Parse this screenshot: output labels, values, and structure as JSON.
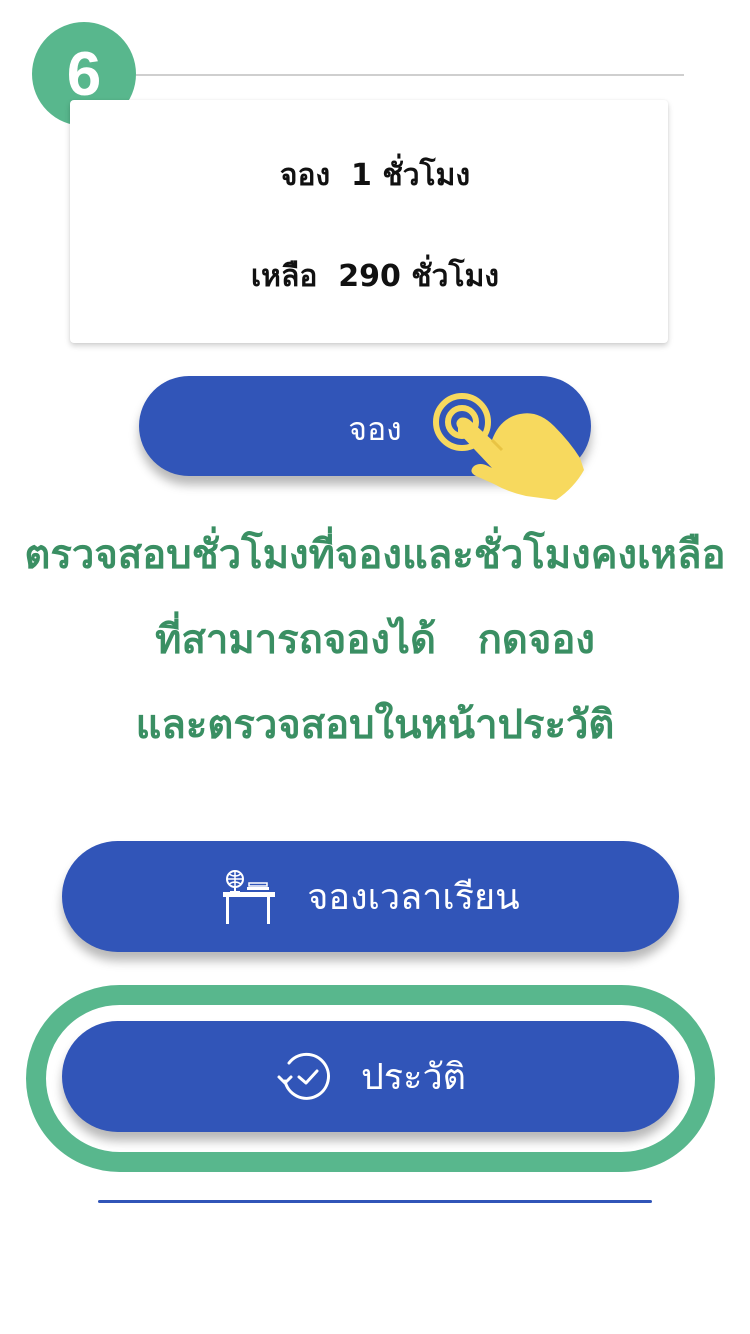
{
  "step": {
    "number": "6"
  },
  "booking_card": {
    "booked_text": "จอง  1 ชั่วโมง",
    "remaining_text": "เหลือ  290 ชั่วโมง"
  },
  "reserve_button": {
    "label": "จอง"
  },
  "instruction": {
    "line1": "ตรวจสอบชั่วโมงที่จองและชั่วโมงคงเหลือ",
    "line2": "ที่สามารถจองได้   กดจอง",
    "line3": "และตรวจสอบในหน้าประวัติ"
  },
  "menu": {
    "schedule": {
      "label": "จองเวลาเรียน",
      "icon": "study-desk-icon"
    },
    "history": {
      "label": "ประวัติ",
      "icon": "history-clock-icon"
    }
  },
  "colors": {
    "accent_green": "#58b78d",
    "instruction_green": "#3a8f63",
    "button_blue": "#3155b8",
    "hand_yellow": "#f7d95e"
  }
}
